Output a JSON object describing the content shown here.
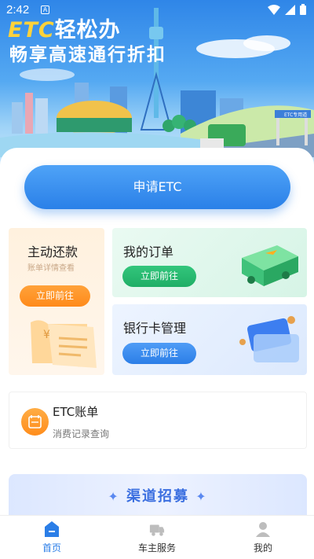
{
  "status_bar": {
    "time": "2:42",
    "notif": "A"
  },
  "banner": {
    "title_etc": "ETC",
    "title_rest": "轻松办",
    "subtitle": "畅享高速通行折扣",
    "sign_text": "ETC专用道"
  },
  "apply_button": {
    "label": "申请ETC"
  },
  "repay_card": {
    "title": "主动还款",
    "subtitle": "账单详情查看",
    "button": "立即前往",
    "receipt_mark": "¥"
  },
  "order_card": {
    "title": "我的订单",
    "button": "立即前往"
  },
  "bank_card": {
    "title": "银行卡管理",
    "button": "立即前往"
  },
  "bill_card": {
    "title": "ETC账单",
    "subtitle": "消费记录查询"
  },
  "recruit_banner": {
    "text": "渠道招募",
    "star": "✦"
  },
  "tabbar": {
    "tabs": [
      {
        "label": "首页",
        "active": true,
        "icon": "home-icon"
      },
      {
        "label": "车主服务",
        "active": false,
        "icon": "truck-icon"
      },
      {
        "label": "我的",
        "active": false,
        "icon": "user-icon"
      }
    ]
  },
  "colors": {
    "primary": "#2b7ee7",
    "orange": "#ff8a1a",
    "green": "#1fae66",
    "recruit": "#3b6fe0"
  }
}
